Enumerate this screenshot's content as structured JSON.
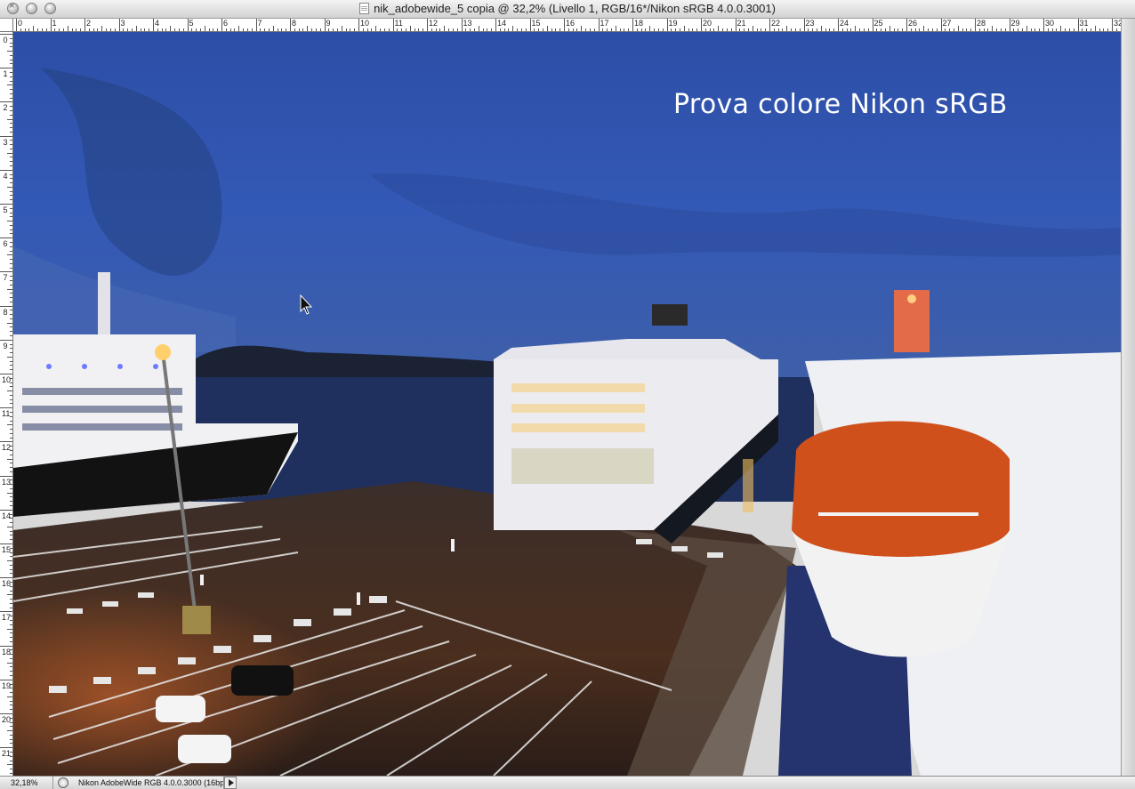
{
  "window": {
    "title": "nik_adobewide_5 copia @ 32,2% (Livello 1, RGB/16*/Nikon sRGB 4.0.0.3001)"
  },
  "rulers": {
    "top_labels": [
      "0",
      "1",
      "2",
      "3",
      "4",
      "5",
      "6",
      "7",
      "8",
      "9",
      "10",
      "11",
      "12",
      "13",
      "14",
      "15",
      "16",
      "17",
      "18",
      "19",
      "20",
      "21",
      "22",
      "23",
      "24",
      "25",
      "26",
      "27",
      "28",
      "29",
      "30",
      "31",
      "32"
    ],
    "left_labels": [
      "0",
      "1",
      "2",
      "3",
      "4",
      "5",
      "6",
      "7",
      "8",
      "9",
      "10",
      "11",
      "12",
      "13",
      "14",
      "15",
      "16",
      "17",
      "18",
      "19",
      "20",
      "21"
    ]
  },
  "canvas": {
    "overlay_text": "Prova colore Nikon sRGB",
    "sky_color": "#3358b8",
    "water_color": "#1f2f5e",
    "pier_color": "#3a2a20"
  },
  "statusbar": {
    "zoom": "32,18%",
    "info": "Nikon AdobeWide RGB 4.0.0.3000 (16bpc)"
  },
  "icons": {
    "close": "close-icon",
    "document": "document-icon",
    "cursor": "arrow-cursor-icon",
    "status": "status-menu-icon",
    "arrow": "triangle-right-icon"
  }
}
